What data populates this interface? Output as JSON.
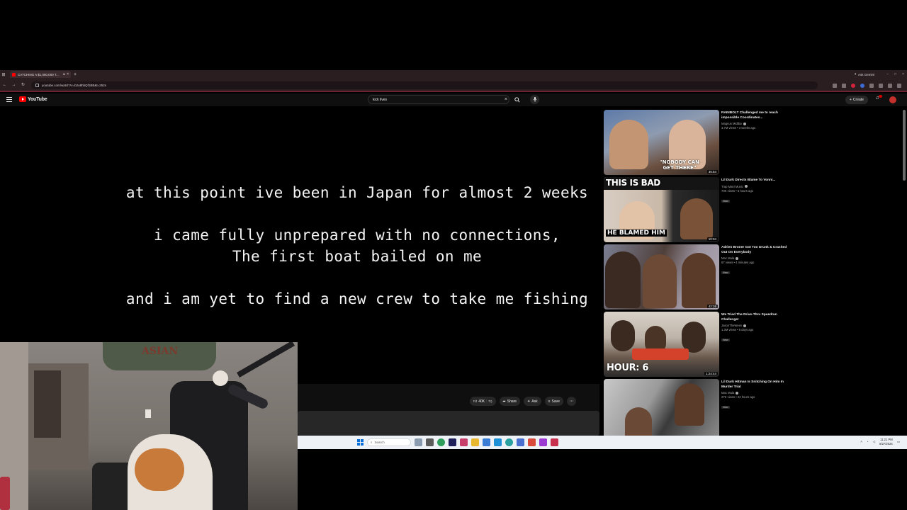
{
  "browser": {
    "tab_title": "CATCHING A $1,000,000 T...",
    "gemini_label": "Ask Gemini",
    "url": "youtube.com/watch?v=b2u8hbQf1BB&t=252s"
  },
  "youtube": {
    "logo_text": "YouTube",
    "search_query": "kick lives",
    "create_label": "Create"
  },
  "video": {
    "captions": [
      "at this point ive been in Japan for almost 2 weeks",
      "i came fully unprepared with no connections,",
      "The first boat bailed on me",
      "and i am yet to find a new crew to take me fishing"
    ],
    "like_count": "40K",
    "share_label": "Share",
    "ask_label": "Ask",
    "save_label": "Save"
  },
  "recommendations": [
    {
      "title": "RAINBOLT Challenged me to reach impossible Coordinates...",
      "channel": "Magnus Midtbø",
      "stats": "3.7M views • 3 weeks ago",
      "duration": "36:54",
      "overlay": "\"NOBODY CAN GET THERE\"",
      "badge": "",
      "colors": [
        "#5c7aa8",
        "#8e9bb0",
        "#b08b6a"
      ]
    },
    {
      "title": "Lil Durk Directs Blame To Vonni...",
      "channel": "Trap Mani Music",
      "stats": "70K views • 5 hours ago",
      "duration": "10:04",
      "overlay_top": "THIS IS BAD",
      "overlay_bottom": "HE BLAMED HIM",
      "badge": "New",
      "colors": [
        "#c9b8a8",
        "#3e5e3a",
        "#1e1e1e"
      ]
    },
    {
      "title": "Adrien Broner Got Too Drunk & Crashed Out On Everybody",
      "channel": "Mac Mula",
      "stats": "67 views • 4 minutes ago",
      "duration": "42:26",
      "badge": "New",
      "colors": [
        "#7b7f93",
        "#4f3f3a",
        "#b0a9b4"
      ]
    },
    {
      "title": "We Tried The Drive-Thru Speedrun Challenge!",
      "channel": "JasonTheWeen",
      "stats": "1.3M views • 5 days ago",
      "duration": "1:24:44",
      "overlay": "HOUR: 6",
      "badge": "New",
      "colors": [
        "#d9d2c8",
        "#6b5a4e",
        "#2a2a2a"
      ]
    },
    {
      "title": "Lil Durk Hitman Is Snitching On Him In Murder Trial",
      "channel": "Mac Mula",
      "stats": "27K views • 22 hours ago",
      "duration": "",
      "badge": "New",
      "colors": [
        "#9a9a9a",
        "#3a3a3a",
        "#c8c8c8"
      ]
    }
  ],
  "taskbar": {
    "search_placeholder": "Search",
    "time": "11:21 PM",
    "date": "8/27/2024"
  }
}
